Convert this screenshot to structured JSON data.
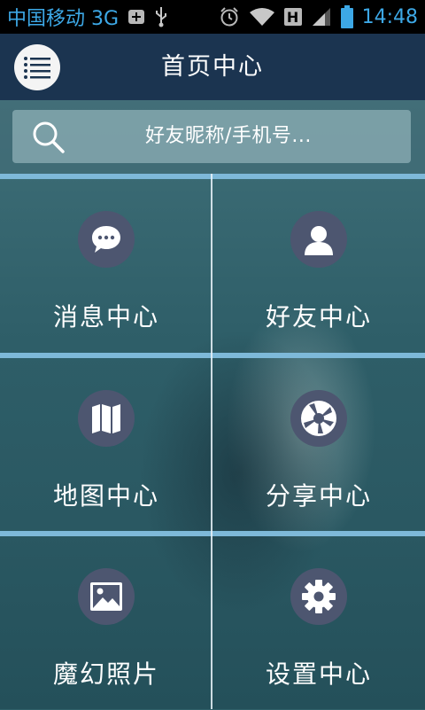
{
  "status_bar": {
    "carrier": "中国移动 3G",
    "time": "14:48",
    "icons": [
      "add-notification-icon",
      "usb-icon",
      "alarm-icon",
      "wifi-icon",
      "hspa-h-icon",
      "signal-icon",
      "battery-icon"
    ],
    "h_label": "H",
    "color": "#3da8e6"
  },
  "header": {
    "title": "首页中心",
    "menu_icon": "list-menu-icon",
    "background": "#1b3450"
  },
  "search": {
    "placeholder": "好友昵称/手机号..."
  },
  "tiles": [
    {
      "label": "消息中心",
      "icon": "chat-bubble-icon"
    },
    {
      "label": "好友中心",
      "icon": "person-icon"
    },
    {
      "label": "地图中心",
      "icon": "map-icon"
    },
    {
      "label": "分享中心",
      "icon": "camera-aperture-icon"
    },
    {
      "label": "魔幻照片",
      "icon": "image-icon"
    },
    {
      "label": "设置中心",
      "icon": "gear-icon"
    }
  ],
  "colors": {
    "divider": "#7eb9d9",
    "icon_circle": "#4d5670"
  }
}
